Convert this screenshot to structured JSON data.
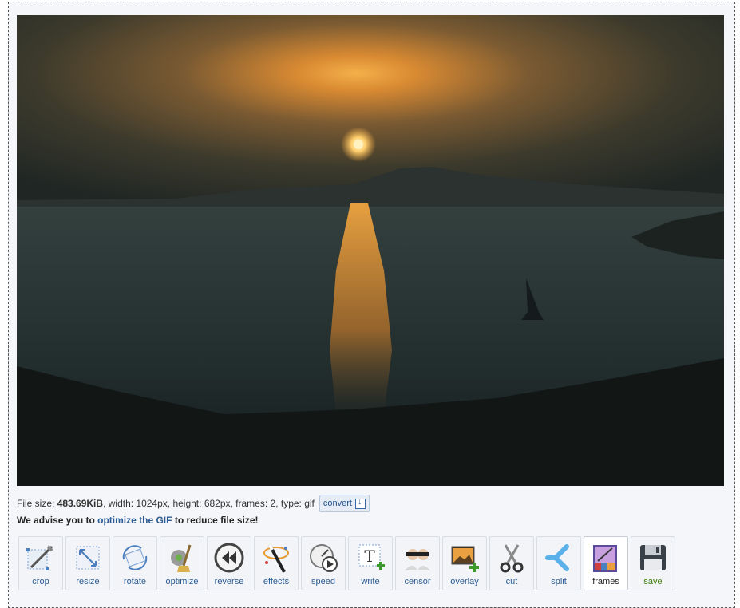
{
  "file_info": {
    "size_label": "File size: ",
    "size_value": "483.69KiB",
    "dims_text": ", width: 1024px, height: 682px, frames: 2, type: gif",
    "convert_label": "convert"
  },
  "advice": {
    "prefix": "We advise you to ",
    "link": "optimize the GIF",
    "suffix": " to reduce file size!"
  },
  "toolbar": {
    "crop": "crop",
    "resize": "resize",
    "rotate": "rotate",
    "optimize": "optimize",
    "reverse": "reverse",
    "effects": "effects",
    "speed": "speed",
    "write": "write",
    "censor": "censor",
    "overlay": "overlay",
    "cut": "cut",
    "split": "split",
    "frames": "frames",
    "save": "save"
  },
  "icons": {
    "crop": "crop-icon",
    "resize": "resize-icon",
    "rotate": "rotate-icon",
    "optimize": "broom-icon",
    "reverse": "rewind-icon",
    "effects": "magic-wand-icon",
    "speed": "stopwatch-icon",
    "write": "text-icon",
    "censor": "censor-icon",
    "overlay": "image-add-icon",
    "cut": "scissors-icon",
    "split": "split-icon",
    "frames": "frames-icon",
    "save": "floppy-disk-icon"
  },
  "colors": {
    "link": "#2b5c95",
    "save_label": "#3b7d0a",
    "panel_bg": "#f5f6f9"
  }
}
